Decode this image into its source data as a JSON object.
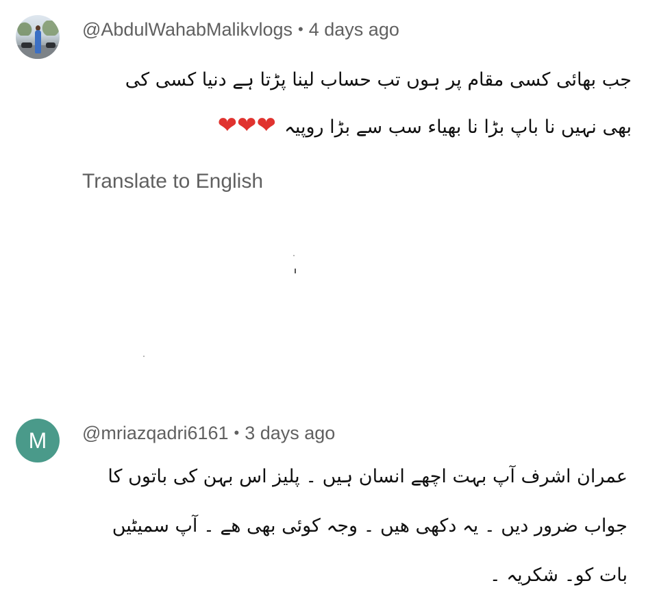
{
  "comments": [
    {
      "author": "@AbdulWahabMalikvlogs",
      "separator": "•",
      "time": "4 days ago",
      "avatar": {
        "type": "photo",
        "description_icon": "user-photo-avatar"
      },
      "lines": [
        "جب بھائی کسی مقام پر ہوں تب حساب لینا پڑتا ہے دنیا کسی کی",
        "بھی نہیں نا باپ بڑا نا بھیاء سب سے بڑا روپیہ"
      ],
      "hearts": "❤❤❤",
      "translate_label": "Translate to English"
    },
    {
      "author": "@mriazqadri6161",
      "separator": "•",
      "time": "3 days ago",
      "avatar": {
        "type": "letter",
        "letter": "M",
        "color": "#4a9a8a"
      },
      "lines": [
        "عمران اشرف آپ بہت اچھے انسان ہیں ۔ پلیز اس بہن کی باتوں کا",
        "جواب ضرور دیں ۔ یہ دکھی ھیں ۔ وجہ کوئی بھی ھے ۔ آپ سمیٹیں",
        "بات کو۔ شکریہ ۔"
      ]
    }
  ],
  "colors": {
    "meta_text": "#606060",
    "body_text": "#0f0f0f",
    "heart": "#e0332f"
  }
}
